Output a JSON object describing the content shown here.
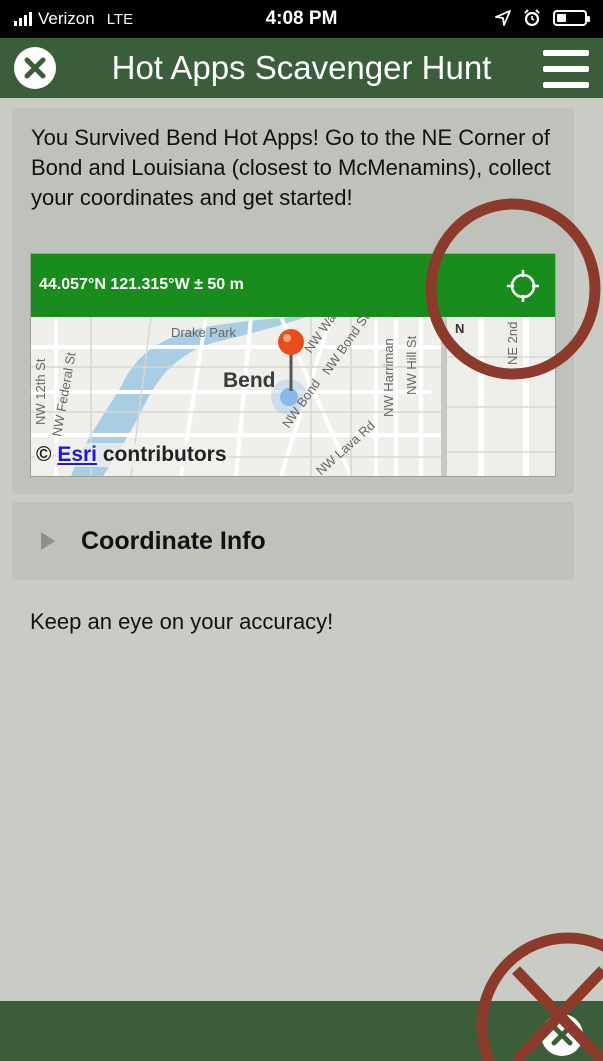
{
  "status_bar": {
    "carrier": "Verizon",
    "network": "LTE",
    "time": "4:08 PM",
    "signal_bars": 4,
    "battery_fraction": 0.35,
    "icons": [
      "signal-icon",
      "location-arrow-icon",
      "alarm-icon",
      "battery-icon"
    ]
  },
  "header": {
    "title": "Hot Apps Scavenger Hunt",
    "close_icon": "close-icon",
    "menu_icon": "hamburger-menu-icon"
  },
  "main": {
    "intro_text": "You Survived Bend Hot Apps! Go to the NE Corner of Bond and Louisiana (closest to McMenamins), collect your coordinates and get started!",
    "map": {
      "coordinates": "44.057°N 121.315°W ± 50 m",
      "locate_icon": "crosshair-icon",
      "labels": {
        "park": "Drake Park",
        "city": "Bend",
        "nw_12th": "NW 12th St",
        "nw_federal": "NW Federal St",
        "nw_wall": "NW Wa",
        "nw_bond": "NW Bond St",
        "nw_lava": "NW Lava Rd",
        "nw_harriman": "NW Harriman",
        "nw_hill": "NW Hill St",
        "nw_bond_pin": "NW Bond",
        "ne": "NE 2nd",
        "n": "N"
      },
      "attribution": {
        "prefix": "©",
        "link": "Esri",
        "suffix": "contributors"
      },
      "colors": {
        "coord_bar": "#188d1d",
        "water": "#a9cde2",
        "pin": "#e84e1b"
      }
    },
    "accordion": {
      "label": "Coordinate Info",
      "icon": "triangle-right-icon",
      "expanded": false
    },
    "note": "Keep an eye on your accuracy!"
  },
  "footer": {
    "button_icon": "close-icon"
  },
  "annotations": {
    "color": "#8b3a2c"
  }
}
